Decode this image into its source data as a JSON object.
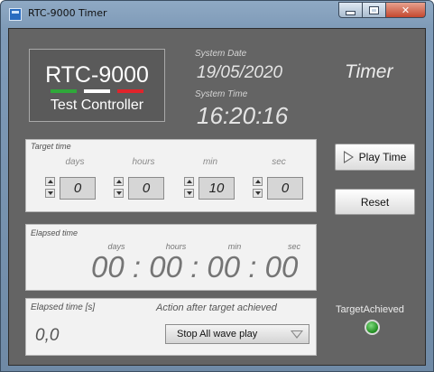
{
  "window": {
    "title": "RTC-9000 Timer"
  },
  "logo": {
    "title": "RTC-9000",
    "subtitle": "Test Controller",
    "stripe_colors": [
      "#2fa83a",
      "#ffffff",
      "#e0242b"
    ]
  },
  "system": {
    "date_label": "System Date",
    "date_value": "19/05/2020",
    "time_label": "System Time",
    "time_value": "16:20:16"
  },
  "heading": "Timer",
  "target": {
    "label": "Target time",
    "fields": [
      {
        "unit": "days",
        "value": "0"
      },
      {
        "unit": "hours",
        "value": "0"
      },
      {
        "unit": "min",
        "value": "10"
      },
      {
        "unit": "sec",
        "value": "0"
      }
    ]
  },
  "elapsed": {
    "label": "Elapsed time",
    "units": [
      "days",
      "hours",
      "min",
      "sec"
    ],
    "value": "00 : 00 : 00 : 00"
  },
  "elapsed_seconds": {
    "label": "Elapsed time [s]",
    "value": "0,0"
  },
  "action": {
    "label": "Action after target achieved",
    "selected": "Stop All wave play"
  },
  "buttons": {
    "play": "Play Time",
    "reset": "Reset"
  },
  "indicator": {
    "label": "TargetAchieved",
    "color": "#2fa83a"
  }
}
